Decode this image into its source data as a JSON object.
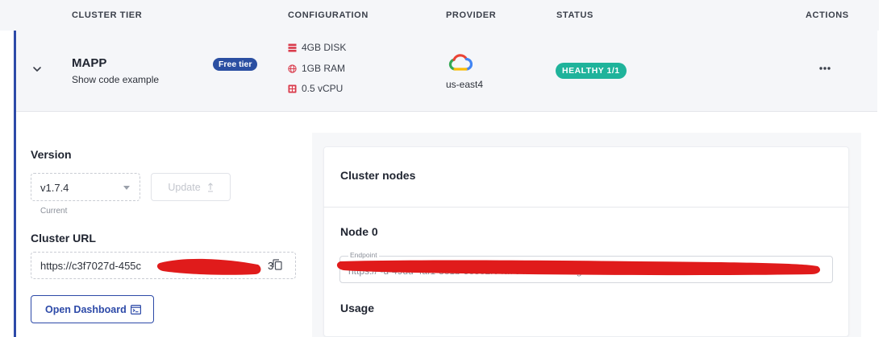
{
  "table": {
    "headers": {
      "tier": "CLUSTER TIER",
      "configuration": "CONFIGURATION",
      "provider": "PROVIDER",
      "status": "STATUS",
      "actions": "ACTIONS"
    }
  },
  "cluster": {
    "name": "MAPP",
    "subtitle": "Show code example",
    "tier_badge": "Free tier",
    "config": {
      "disk": "4GB DISK",
      "ram": "1GB RAM",
      "cpu": "0.5 vCPU"
    },
    "provider_logo": "google-cloud-logo",
    "region": "us-east4",
    "status": "HEALTHY 1/1"
  },
  "details": {
    "version_label": "Version",
    "version_value": "v1.7.4",
    "version_hint": "Current",
    "update_label": "Update",
    "url_label": "Cluster URL",
    "url_value": "https://c3f7027d-455c",
    "url_tail": "3",
    "dashboard_label": "Open Dashboard"
  },
  "nodes": {
    "title": "Cluster nodes",
    "node_title": "Node 0",
    "endpoint_label": "Endpoint",
    "endpoint_value": "https://                 -d-49dd-4af1-8e1b-5e5e2f04a764.us-east4-0.g",
    "usage_label": "Usage"
  },
  "colors": {
    "accent": "#2d4aa8",
    "badge_free": "#2b4fa2",
    "status_healthy": "#1fb39b",
    "redaction": "#e01b1b"
  }
}
